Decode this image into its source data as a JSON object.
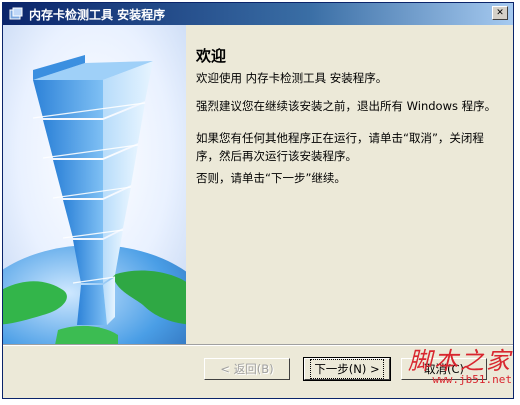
{
  "window": {
    "title": "内存卡检测工具 安装程序",
    "close_symbol": "✕"
  },
  "content": {
    "heading": "欢迎",
    "paragraphs": [
      "欢迎使用 内存卡检测工具 安装程序。",
      "强烈建议您在继续该安装之前，退出所有 Windows 程序。",
      "如果您有任何其他程序正在运行，请单击“取消”，关闭程序，然后再次运行该安装程序。",
      "否则，请单击“下一步”继续。"
    ]
  },
  "buttons": {
    "back": "< 返回(B)",
    "next": "下一步(N) >",
    "cancel": "取消(C)"
  },
  "watermark": {
    "text": "脚本之家",
    "url": "www.jb51.net",
    "color": "#d8262f"
  },
  "colors": {
    "title_bar": "#0a246a",
    "dialog_bg": "#ece9d8"
  },
  "icons": {
    "app": "installer-icon",
    "close": "close-icon",
    "illustration": "tower-globe-illustration"
  }
}
